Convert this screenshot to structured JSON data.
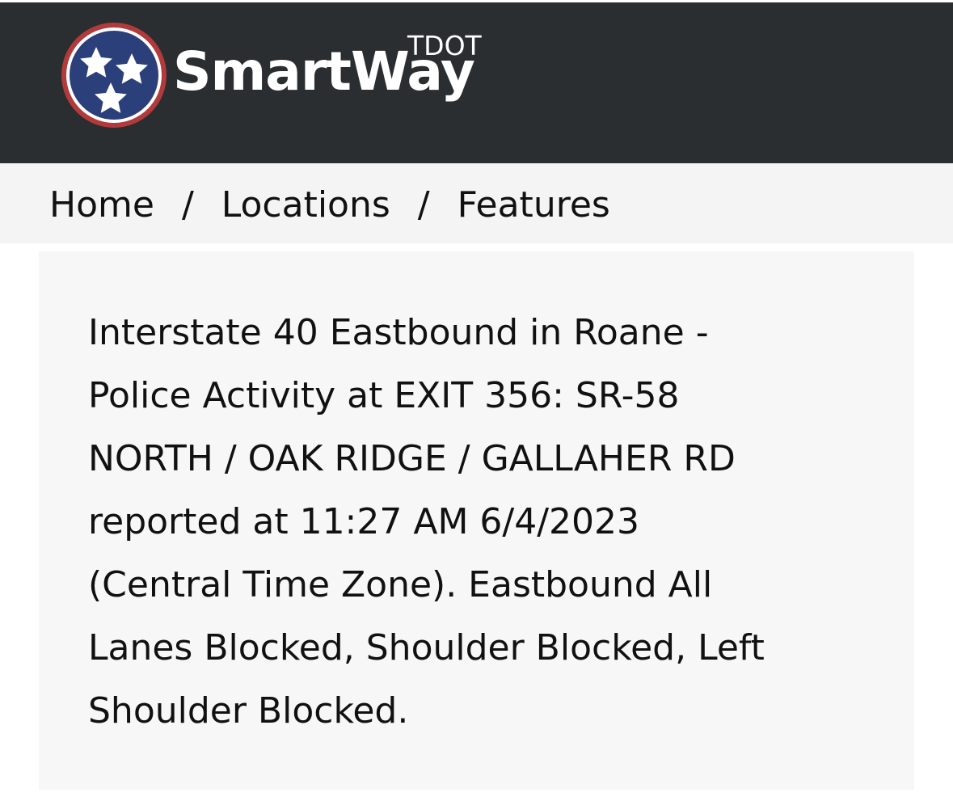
{
  "header": {
    "brand": "SmartWay",
    "brand_sup": "TDOT",
    "colors": {
      "bar": "#2b2e31",
      "seal_ring": "#b23a3a",
      "seal_field": "#2b3f7a",
      "star": "#ffffff"
    },
    "logo_icon": "tennessee-tristar-seal-icon"
  },
  "breadcrumb": {
    "items": [
      "Home",
      "Locations",
      "Features"
    ],
    "separator": "/"
  },
  "incident": {
    "lines": [
      "Interstate 40 Eastbound in Roane -",
      "Police Activity at EXIT 356: SR-58",
      "NORTH / OAK RIDGE / GALLAHER RD",
      "reported at 11:27 AM 6/4/2023",
      "(Central Time Zone). Eastbound All",
      "Lanes Blocked, Shoulder Blocked, Left",
      "Shoulder Blocked."
    ]
  }
}
